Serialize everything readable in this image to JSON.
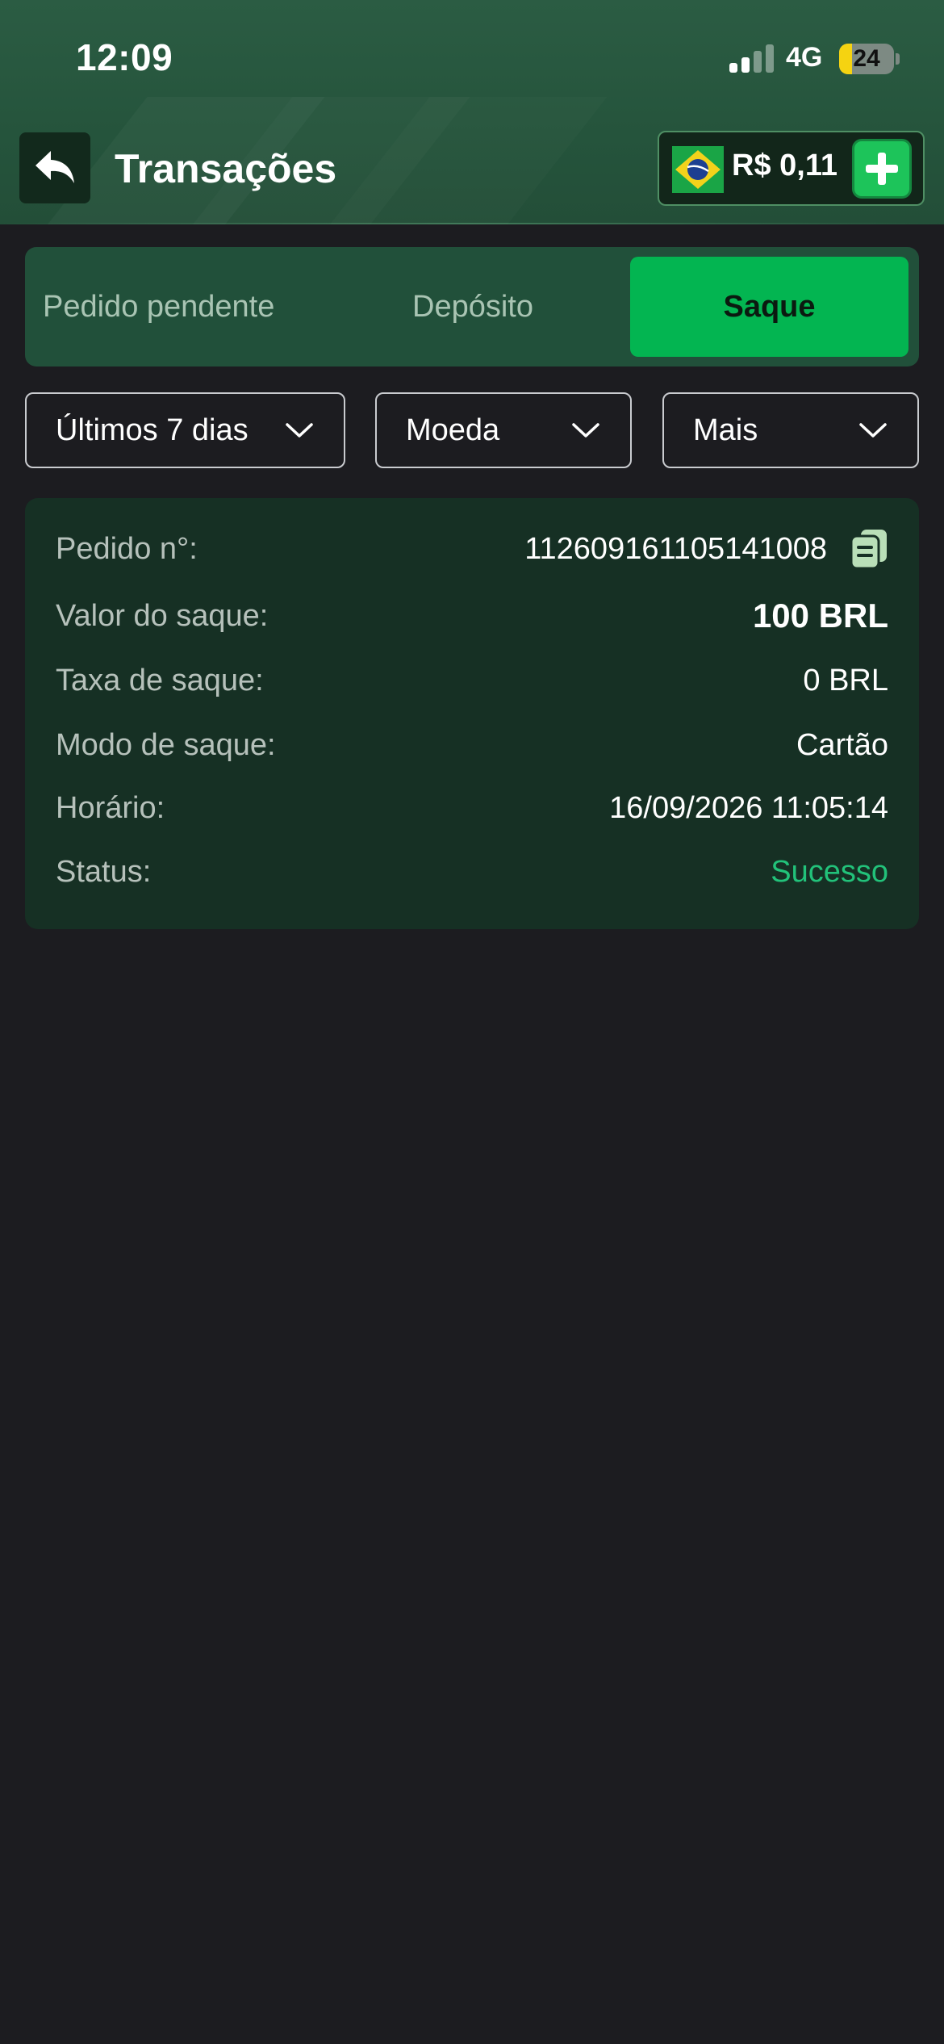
{
  "status_bar": {
    "time": "12:09",
    "network": "4G",
    "battery": "24",
    "battery_level": 0.24
  },
  "nav": {
    "back_icon": "reply-arrow-icon",
    "title": "Transações",
    "balance": {
      "flag_icon": "brazil-flag-icon",
      "amount": "R$ 0,11",
      "add_icon": "plus-icon"
    }
  },
  "tabs": [
    {
      "label": "Pedido pendente",
      "active": false
    },
    {
      "label": "Depósito",
      "active": false
    },
    {
      "label": "Saque",
      "active": true
    }
  ],
  "filters": [
    {
      "label": "Últimos 7 dias",
      "icon": "chevron-down-icon"
    },
    {
      "label": "Moeda",
      "icon": "chevron-down-icon"
    },
    {
      "label": "Mais",
      "icon": "chevron-down-icon"
    }
  ],
  "transaction": {
    "order": {
      "label": "Pedido n°:",
      "value": "112609161105141008",
      "icon": "copy-icon"
    },
    "amount": {
      "label": "Valor do saque:",
      "value": "100 BRL"
    },
    "fee": {
      "label": "Taxa de saque:",
      "value": "0 BRL"
    },
    "mode": {
      "label": "Modo de saque:",
      "value": "Cartão"
    },
    "time": {
      "label": "Horário:",
      "value": "16/09/2026 11:05:14"
    },
    "status": {
      "label": "Status:",
      "value": "Sucesso"
    }
  },
  "colors": {
    "header": "#25543c",
    "accent_green": "#03b551",
    "success": "#22c27a",
    "background": "#1c1c20",
    "card": "#163024"
  }
}
